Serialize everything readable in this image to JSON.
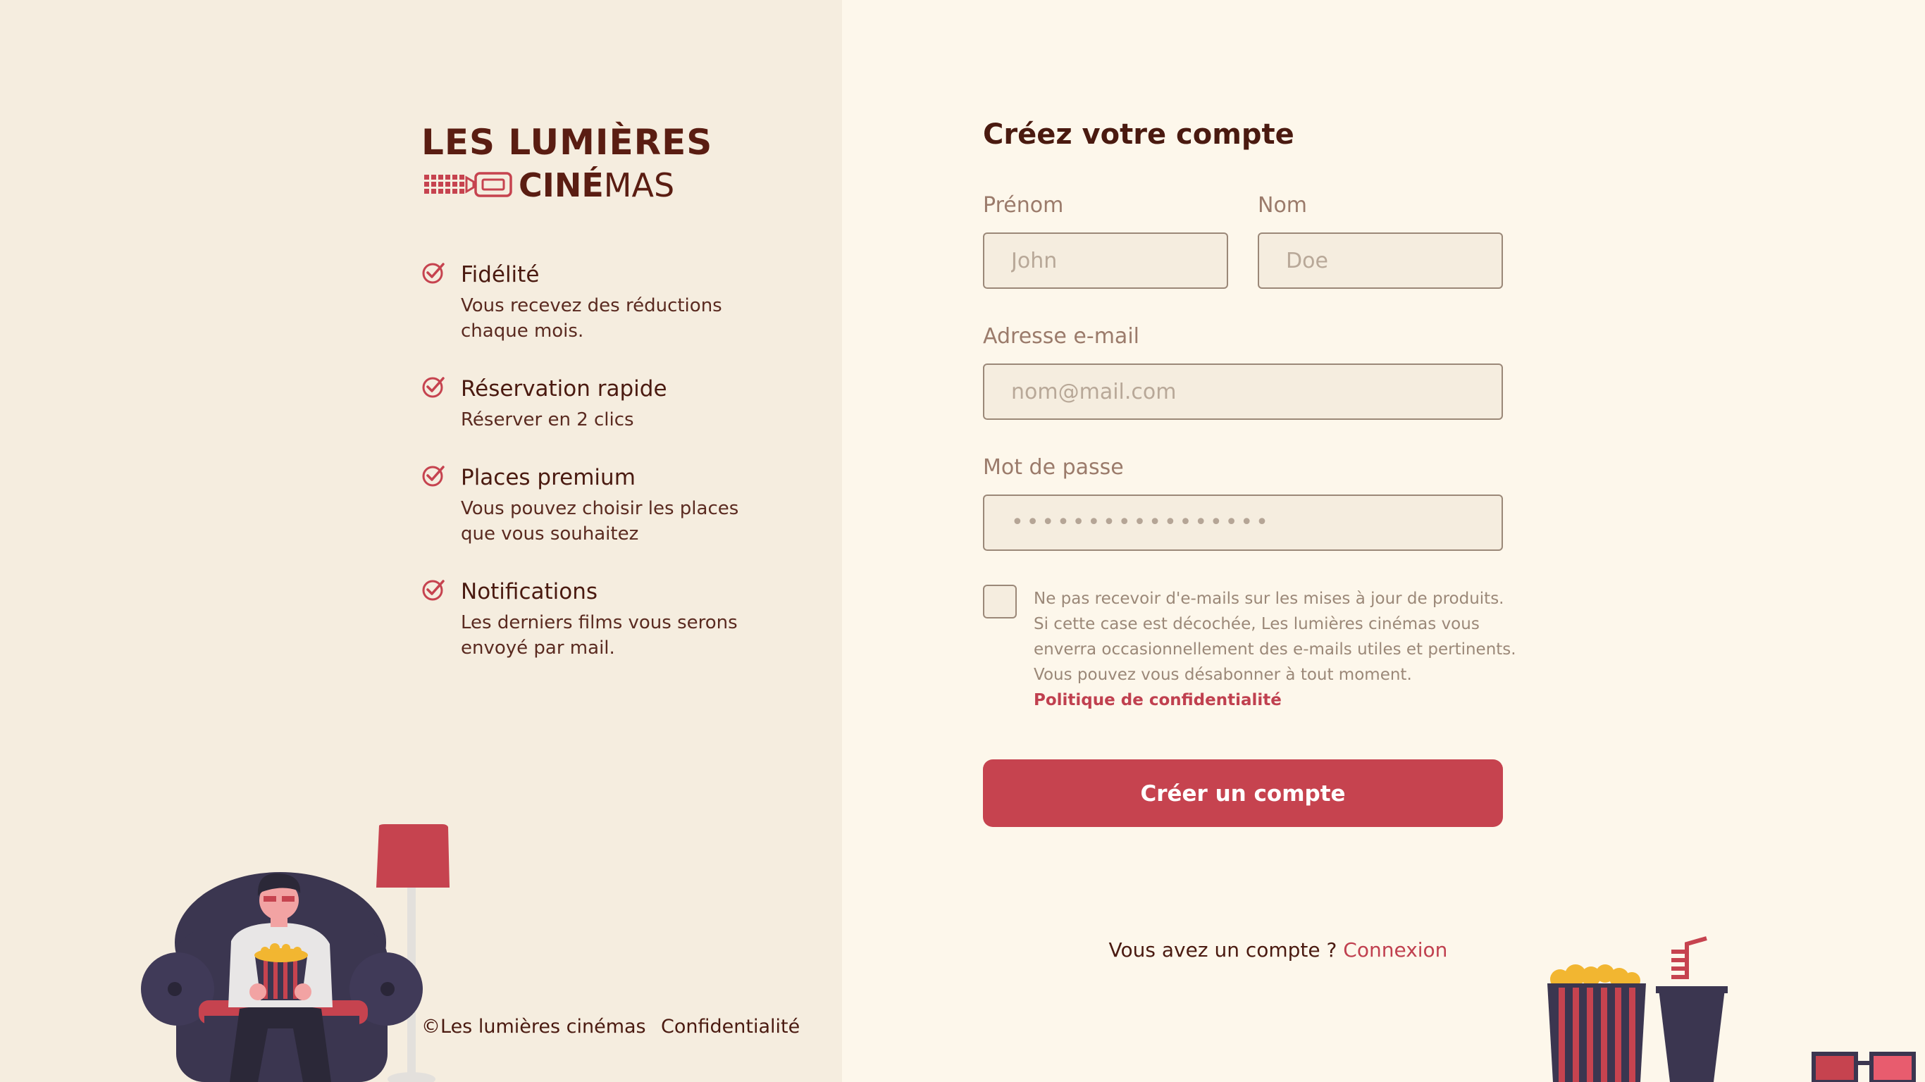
{
  "brand": {
    "line1": "LES LUMIÈRES",
    "line2_bold": "CINÉ",
    "line2_light": "MAS"
  },
  "features": [
    {
      "title": "Fidélité",
      "desc_line1": "Vous recevez des réductions",
      "desc_line2": "chaque mois."
    },
    {
      "title": "Réservation rapide",
      "desc_line1": "Réserver en 2 clics",
      "desc_line2": ""
    },
    {
      "title": "Places premium",
      "desc_line1": "Vous pouvez choisir les places",
      "desc_line2": "que vous souhaitez"
    },
    {
      "title": "Notifications",
      "desc_line1": "Les derniers films vous serons",
      "desc_line2": "envoyé par mail."
    }
  ],
  "footer": {
    "copyright": "©Les lumières cinémas",
    "privacy": "Confidentialité"
  },
  "form": {
    "title": "Créez votre compte",
    "firstname_label": "Prénom",
    "firstname_placeholder": "John",
    "lastname_label": "Nom",
    "lastname_placeholder": "Doe",
    "email_label": "Adresse e-mail",
    "email_placeholder": "nom@mail.com",
    "password_label": "Mot de passe",
    "password_value": "•••••••••••••••••",
    "consent_line1": "Ne pas recevoir d'e-mails sur les mises à jour de produits.",
    "consent_line2": "Si cette case est décochée, Les lumières cinémas vous",
    "consent_line3": "enverra occasionnellement des e-mails utiles et pertinents.",
    "consent_line4": "Vous pouvez vous désabonner à tout moment.",
    "policy_link": "Politique de confidentialité",
    "submit_label": "Créer un compte",
    "has_account": "Vous avez un compte ?",
    "login_link": "Connexion"
  },
  "colors": {
    "left_bg": "#F5EDDF",
    "right_bg": "#FDF7EB",
    "accent": "#C6434F",
    "text_dark": "#4A1A10",
    "muted": "#9B7B6B"
  }
}
